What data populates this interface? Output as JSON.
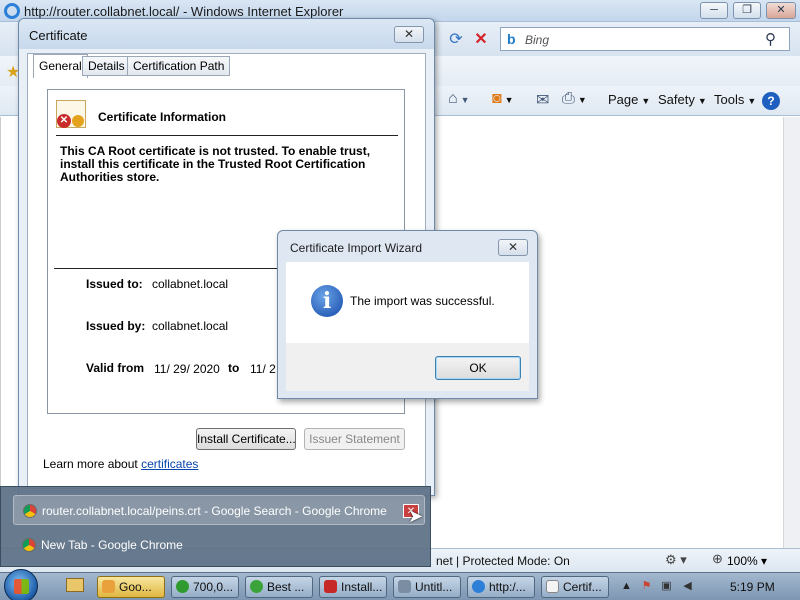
{
  "ie": {
    "title": "http://router.collabnet.local/ - Windows Internet Explorer",
    "search_placeholder": "Bing",
    "commands": {
      "page": "Page",
      "safety": "Safety",
      "tools": "Tools"
    },
    "status_zone": "net | Protected Mode: On",
    "zoom": "100%"
  },
  "cert_dialog": {
    "title": "Certificate",
    "tabs": [
      "General",
      "Details",
      "Certification Path"
    ],
    "info_title": "Certificate Information",
    "warning": "This CA Root certificate is not trusted. To enable trust, install this certificate in the Trusted Root Certification Authorities store.",
    "issued_to_label": "Issued to:",
    "issued_to": "collabnet.local",
    "issued_by_label": "Issued by:",
    "issued_by": "collabnet.local",
    "valid_from_label": "Valid from",
    "valid_from": "11/ 29/ 2020",
    "valid_to_label": "to",
    "valid_to": "11/ 2",
    "install_button": "Install Certificate...",
    "issuer_statement_button": "Issuer Statement",
    "learn_more_text": "Learn more about ",
    "learn_more_link": "certificates"
  },
  "import_wizard": {
    "title": "Certificate Import Wizard",
    "message": "The import was successful.",
    "ok_button": "OK"
  },
  "taskbar_popup": {
    "items": [
      "router.collabnet.local/peins.crt - Google Search - Google Chrome",
      "New Tab - Google Chrome"
    ]
  },
  "taskbar": {
    "tasks": [
      "Goo...",
      "700,0...",
      "Best ...",
      "Install...",
      "Untitl...",
      "http:/...",
      "Certif..."
    ],
    "clock": "5:19 PM"
  }
}
